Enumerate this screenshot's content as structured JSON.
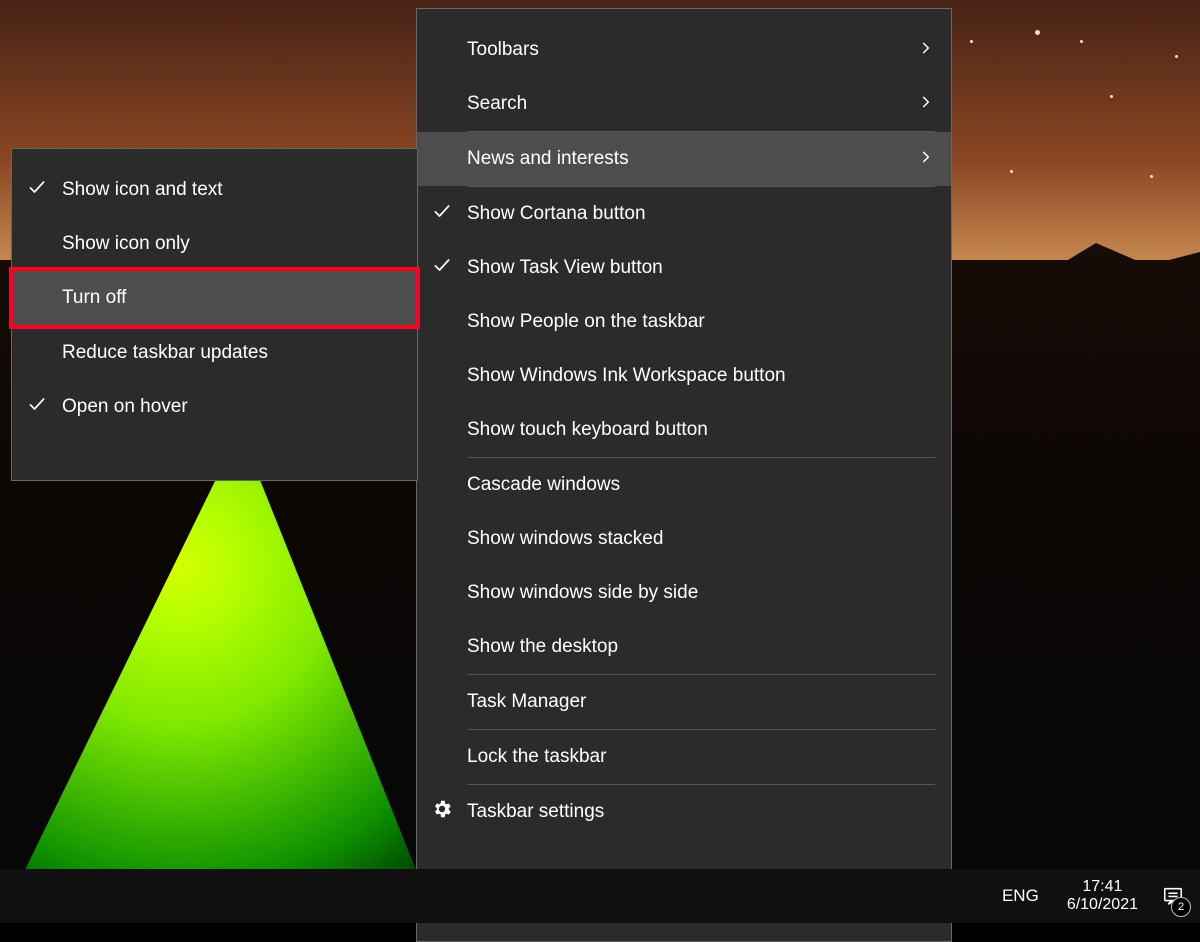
{
  "main_menu": {
    "items": [
      {
        "label": "Toolbars",
        "submenu": true
      },
      {
        "label": "Search",
        "submenu": true
      },
      {
        "label": "News and interests",
        "submenu": true,
        "selected": true
      },
      {
        "label": "Show Cortana button",
        "checked": true
      },
      {
        "label": "Show Task View button",
        "checked": true
      },
      {
        "label": "Show People on the taskbar"
      },
      {
        "label": "Show Windows Ink Workspace button"
      },
      {
        "label": "Show touch keyboard button"
      },
      {
        "label": "Cascade windows"
      },
      {
        "label": "Show windows stacked"
      },
      {
        "label": "Show windows side by side"
      },
      {
        "label": "Show the desktop"
      },
      {
        "label": "Task Manager"
      },
      {
        "label": "Lock the taskbar"
      },
      {
        "label": "Taskbar settings",
        "icon": "gear"
      }
    ],
    "separators_after": [
      1,
      2,
      7,
      11,
      12,
      13
    ]
  },
  "sub_menu": {
    "items": [
      {
        "label": "Show icon and text",
        "checked": true
      },
      {
        "label": "Show icon only"
      },
      {
        "label": "Turn off",
        "selected": true,
        "highlighted": true
      },
      {
        "label": "Reduce taskbar updates"
      },
      {
        "label": "Open on hover",
        "checked": true
      }
    ],
    "separators_after": [
      2
    ]
  },
  "tray": {
    "language": "ENG",
    "time": "17:41",
    "date": "6/10/2021",
    "badge_count": "2"
  }
}
